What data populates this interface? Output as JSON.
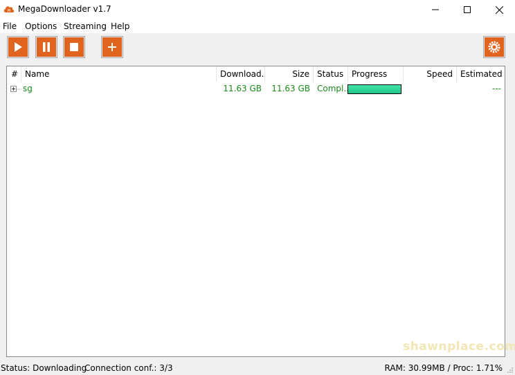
{
  "window": {
    "title": "MegaDownloader v1.7",
    "minimize_icon": "minimize-icon",
    "maximize_icon": "maximize-icon",
    "close_icon": "close-icon"
  },
  "menu": [
    "File",
    "Options",
    "Streaming",
    "Help"
  ],
  "toolbar": {
    "buttons": [
      {
        "name": "start",
        "icon": "play-icon"
      },
      {
        "name": "pause",
        "icon": "pause-icon"
      },
      {
        "name": "stop",
        "icon": "stop-icon"
      },
      {
        "name": "add",
        "icon": "plus-icon"
      }
    ],
    "settings_icon": "gear-icon",
    "accent_color": "#e1641e"
  },
  "table": {
    "columns": [
      "#",
      "Name",
      "Download...",
      "Size",
      "Status",
      "Progress",
      "Speed",
      "Estimated"
    ],
    "rows": [
      {
        "name": "sg",
        "downloaded": "11.63 GB",
        "size": "11.63 GB",
        "status": "Compl...",
        "progress": 1.0,
        "speed": "",
        "estimated": "---"
      }
    ],
    "row_text_color": "#1a8a1a",
    "progress_color": "#2fd59a"
  },
  "watermark": "shawnplace.com",
  "statusbar": {
    "status": "Status: Downloading",
    "connection": "Connection conf.: 3/3",
    "resources": "RAM: 30.99MB / Proc: 1.71%"
  }
}
